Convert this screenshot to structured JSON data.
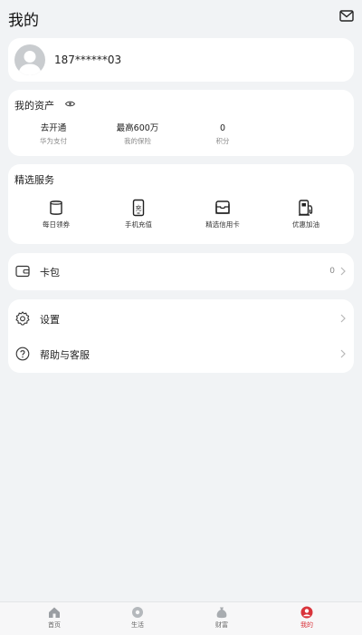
{
  "header": {
    "title": "我的"
  },
  "profile": {
    "phone": "187******03"
  },
  "assets": {
    "title": "我的资产",
    "items": [
      {
        "value": "去开通",
        "label": "华为支付"
      },
      {
        "value": "最高600万",
        "label": "我的保险"
      },
      {
        "value": "0",
        "label": "积分"
      }
    ]
  },
  "services": {
    "title": "精选服务",
    "items": [
      {
        "label": "每日领券",
        "icon": "coupon-icon"
      },
      {
        "label": "手机充值",
        "icon": "phone-recharge-icon",
        "glyph": "充"
      },
      {
        "label": "精选信用卡",
        "icon": "credit-card-icon"
      },
      {
        "label": "优惠加油",
        "icon": "fuel-pump-icon"
      }
    ]
  },
  "wallet": {
    "label": "卡包",
    "count": "0"
  },
  "menu": [
    {
      "label": "设置",
      "icon": "settings-gear-icon"
    },
    {
      "label": "帮助与客服",
      "icon": "help-question-icon"
    }
  ],
  "tabbar": {
    "tabs": [
      {
        "label": "首页",
        "icon": "home-icon"
      },
      {
        "label": "生活",
        "icon": "life-icon"
      },
      {
        "label": "财富",
        "icon": "wealth-icon"
      },
      {
        "label": "我的",
        "icon": "me-icon",
        "active": true
      }
    ]
  },
  "colors": {
    "accent": "#d9343b",
    "background": "#f1f3f5",
    "card": "#ffffff"
  }
}
